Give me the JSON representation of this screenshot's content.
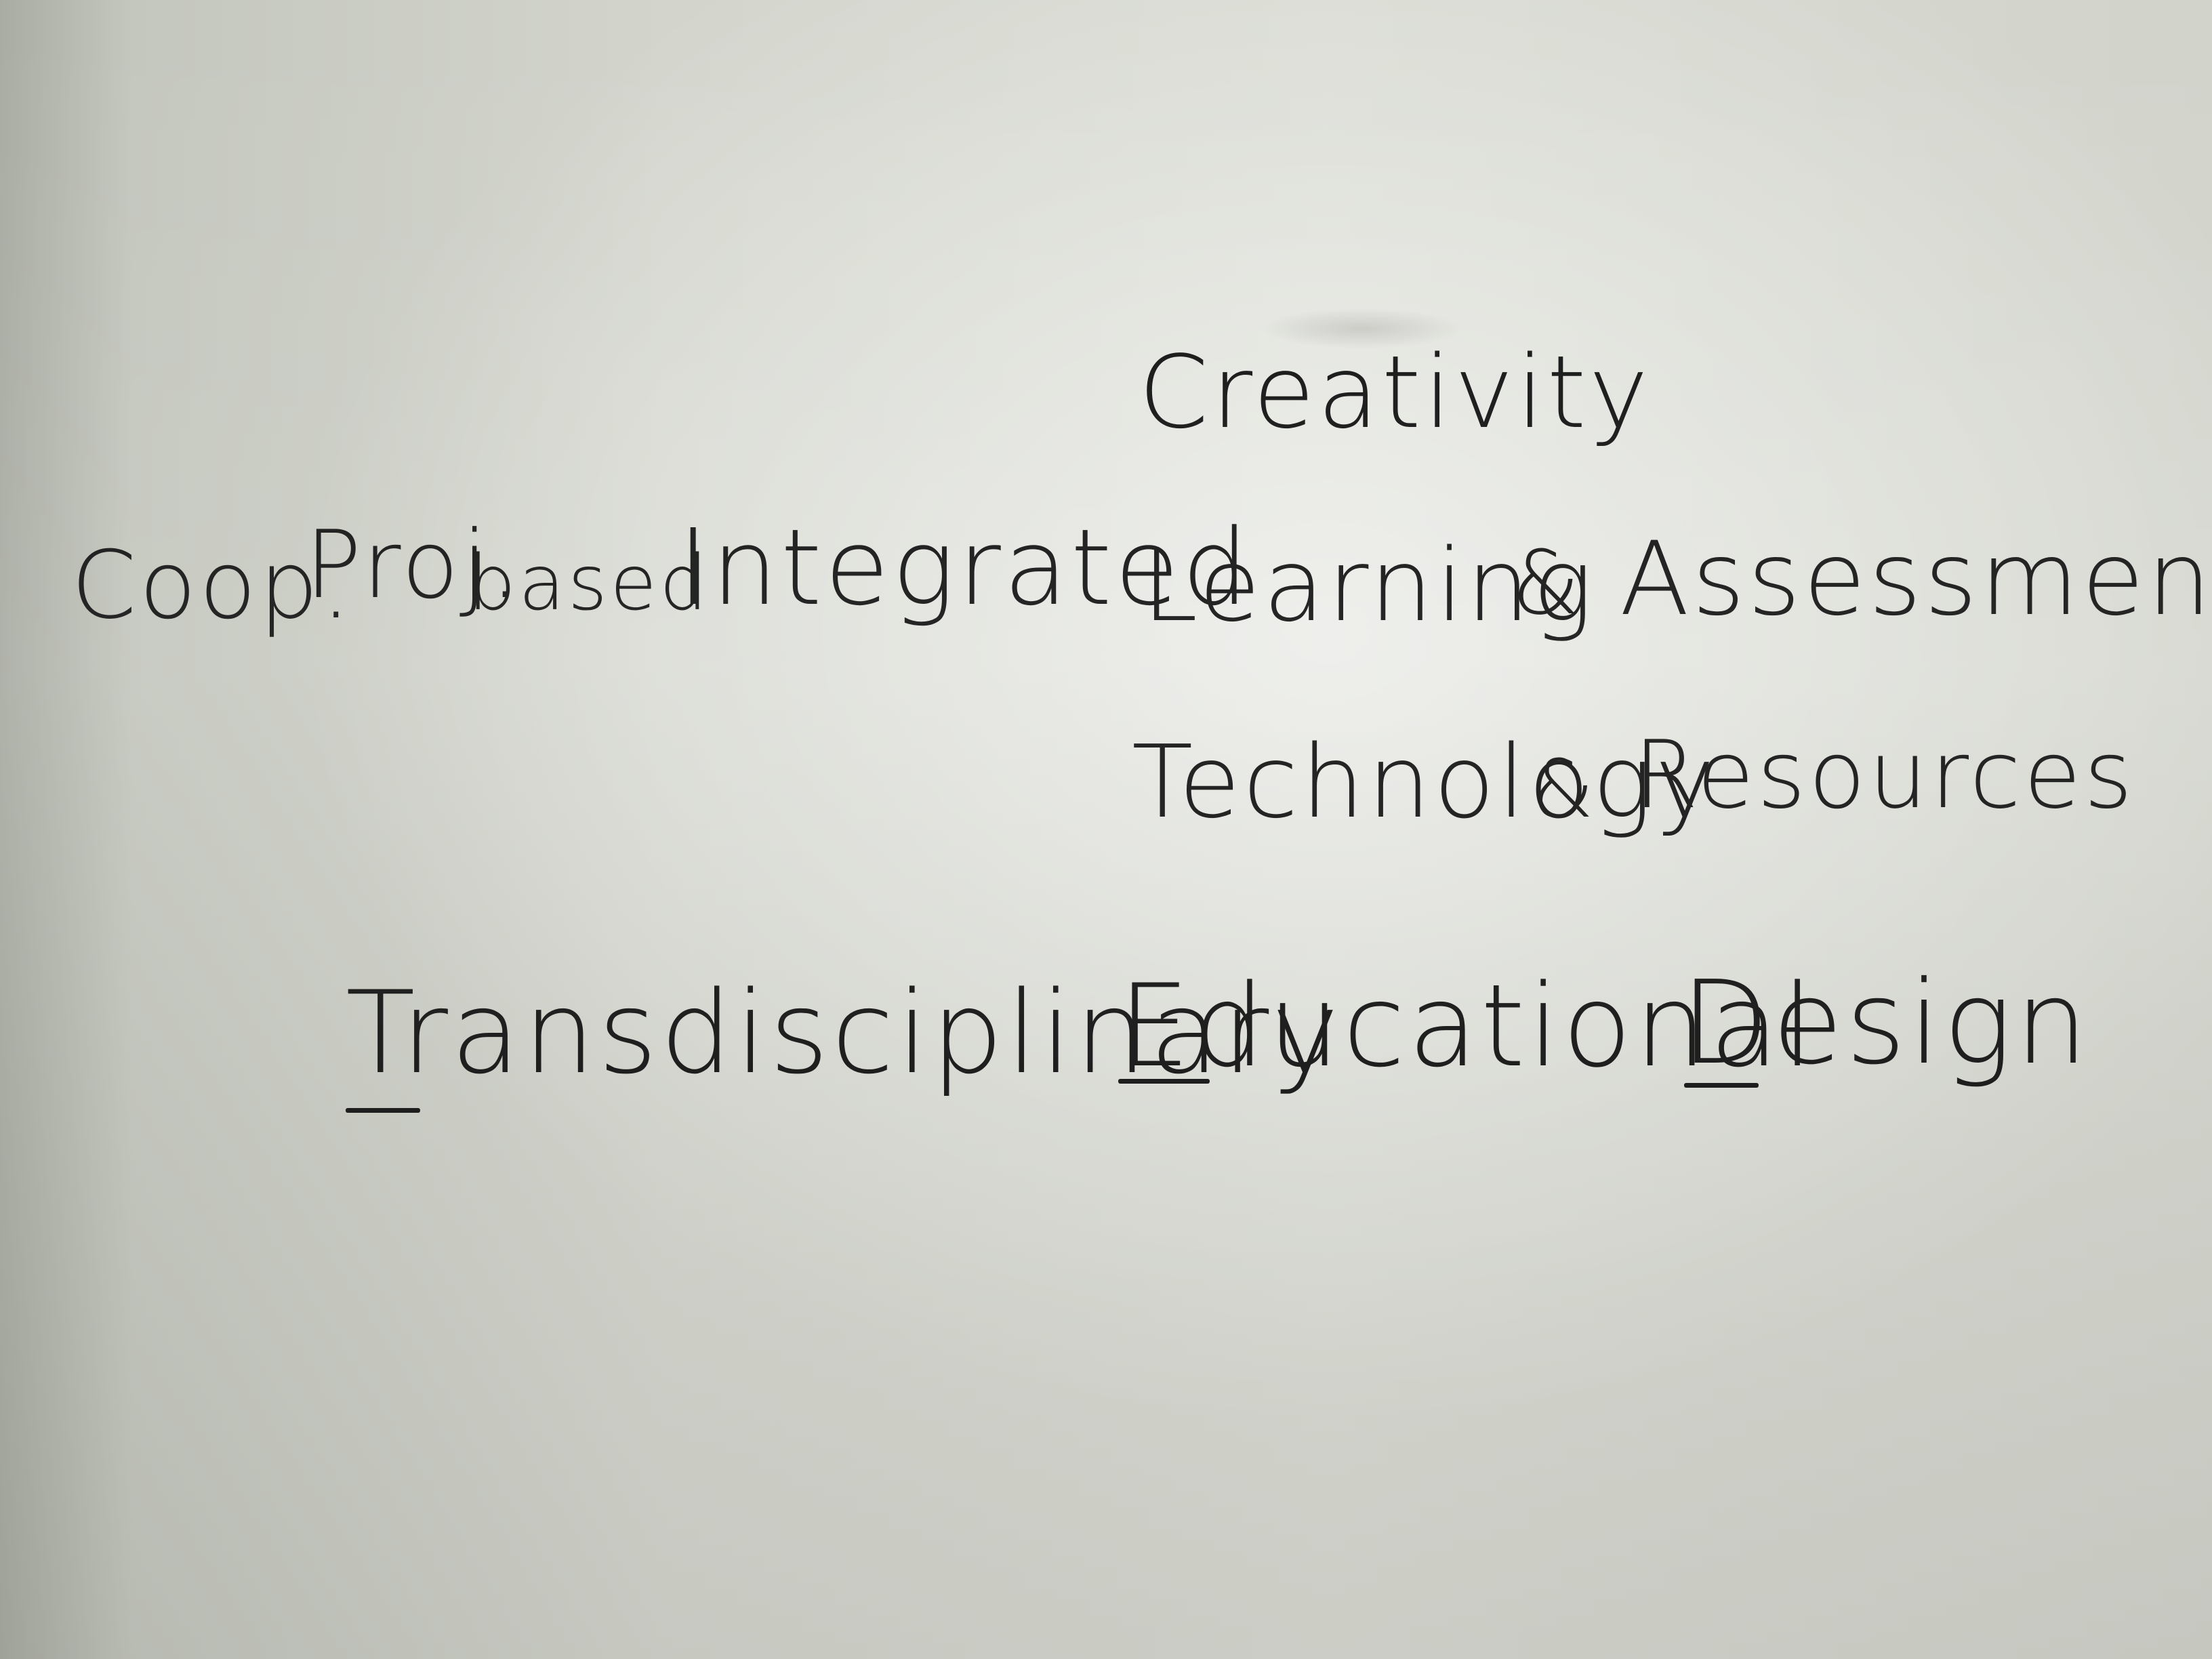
{
  "whiteboard": {
    "line1": {
      "word": "Creativity"
    },
    "line2": {
      "coop": "Coop.",
      "proj": "Proj.",
      "based": "based",
      "integrated": "Integrated",
      "learning": "Learning",
      "ampersand": "&",
      "assessment": "Assessment"
    },
    "line3": {
      "technology": "Technology",
      "ampersand": "&",
      "resources": "Resources"
    },
    "line4": {
      "transdisciplinary": "Transdisciplinary",
      "educational": "Educational",
      "design": "Design"
    },
    "ink_color": "#141414",
    "board_color": "#d3d5cd"
  }
}
